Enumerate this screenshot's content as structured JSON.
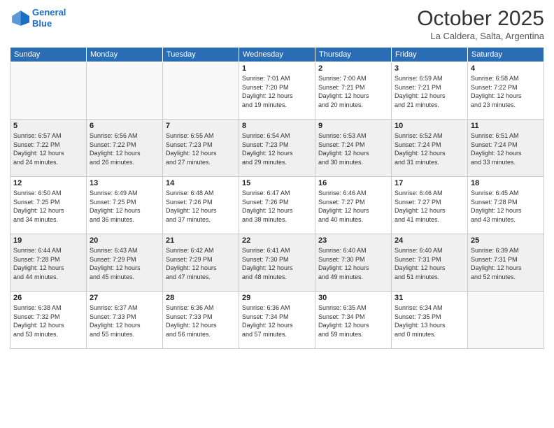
{
  "header": {
    "logo_line1": "General",
    "logo_line2": "Blue",
    "month": "October 2025",
    "location": "La Caldera, Salta, Argentina"
  },
  "weekdays": [
    "Sunday",
    "Monday",
    "Tuesday",
    "Wednesday",
    "Thursday",
    "Friday",
    "Saturday"
  ],
  "weeks": [
    [
      {
        "day": "",
        "info": ""
      },
      {
        "day": "",
        "info": ""
      },
      {
        "day": "",
        "info": ""
      },
      {
        "day": "1",
        "info": "Sunrise: 7:01 AM\nSunset: 7:20 PM\nDaylight: 12 hours\nand 19 minutes."
      },
      {
        "day": "2",
        "info": "Sunrise: 7:00 AM\nSunset: 7:21 PM\nDaylight: 12 hours\nand 20 minutes."
      },
      {
        "day": "3",
        "info": "Sunrise: 6:59 AM\nSunset: 7:21 PM\nDaylight: 12 hours\nand 21 minutes."
      },
      {
        "day": "4",
        "info": "Sunrise: 6:58 AM\nSunset: 7:22 PM\nDaylight: 12 hours\nand 23 minutes."
      }
    ],
    [
      {
        "day": "5",
        "info": "Sunrise: 6:57 AM\nSunset: 7:22 PM\nDaylight: 12 hours\nand 24 minutes."
      },
      {
        "day": "6",
        "info": "Sunrise: 6:56 AM\nSunset: 7:22 PM\nDaylight: 12 hours\nand 26 minutes."
      },
      {
        "day": "7",
        "info": "Sunrise: 6:55 AM\nSunset: 7:23 PM\nDaylight: 12 hours\nand 27 minutes."
      },
      {
        "day": "8",
        "info": "Sunrise: 6:54 AM\nSunset: 7:23 PM\nDaylight: 12 hours\nand 29 minutes."
      },
      {
        "day": "9",
        "info": "Sunrise: 6:53 AM\nSunset: 7:24 PM\nDaylight: 12 hours\nand 30 minutes."
      },
      {
        "day": "10",
        "info": "Sunrise: 6:52 AM\nSunset: 7:24 PM\nDaylight: 12 hours\nand 31 minutes."
      },
      {
        "day": "11",
        "info": "Sunrise: 6:51 AM\nSunset: 7:24 PM\nDaylight: 12 hours\nand 33 minutes."
      }
    ],
    [
      {
        "day": "12",
        "info": "Sunrise: 6:50 AM\nSunset: 7:25 PM\nDaylight: 12 hours\nand 34 minutes."
      },
      {
        "day": "13",
        "info": "Sunrise: 6:49 AM\nSunset: 7:25 PM\nDaylight: 12 hours\nand 36 minutes."
      },
      {
        "day": "14",
        "info": "Sunrise: 6:48 AM\nSunset: 7:26 PM\nDaylight: 12 hours\nand 37 minutes."
      },
      {
        "day": "15",
        "info": "Sunrise: 6:47 AM\nSunset: 7:26 PM\nDaylight: 12 hours\nand 38 minutes."
      },
      {
        "day": "16",
        "info": "Sunrise: 6:46 AM\nSunset: 7:27 PM\nDaylight: 12 hours\nand 40 minutes."
      },
      {
        "day": "17",
        "info": "Sunrise: 6:46 AM\nSunset: 7:27 PM\nDaylight: 12 hours\nand 41 minutes."
      },
      {
        "day": "18",
        "info": "Sunrise: 6:45 AM\nSunset: 7:28 PM\nDaylight: 12 hours\nand 43 minutes."
      }
    ],
    [
      {
        "day": "19",
        "info": "Sunrise: 6:44 AM\nSunset: 7:28 PM\nDaylight: 12 hours\nand 44 minutes."
      },
      {
        "day": "20",
        "info": "Sunrise: 6:43 AM\nSunset: 7:29 PM\nDaylight: 12 hours\nand 45 minutes."
      },
      {
        "day": "21",
        "info": "Sunrise: 6:42 AM\nSunset: 7:29 PM\nDaylight: 12 hours\nand 47 minutes."
      },
      {
        "day": "22",
        "info": "Sunrise: 6:41 AM\nSunset: 7:30 PM\nDaylight: 12 hours\nand 48 minutes."
      },
      {
        "day": "23",
        "info": "Sunrise: 6:40 AM\nSunset: 7:30 PM\nDaylight: 12 hours\nand 49 minutes."
      },
      {
        "day": "24",
        "info": "Sunrise: 6:40 AM\nSunset: 7:31 PM\nDaylight: 12 hours\nand 51 minutes."
      },
      {
        "day": "25",
        "info": "Sunrise: 6:39 AM\nSunset: 7:31 PM\nDaylight: 12 hours\nand 52 minutes."
      }
    ],
    [
      {
        "day": "26",
        "info": "Sunrise: 6:38 AM\nSunset: 7:32 PM\nDaylight: 12 hours\nand 53 minutes."
      },
      {
        "day": "27",
        "info": "Sunrise: 6:37 AM\nSunset: 7:33 PM\nDaylight: 12 hours\nand 55 minutes."
      },
      {
        "day": "28",
        "info": "Sunrise: 6:36 AM\nSunset: 7:33 PM\nDaylight: 12 hours\nand 56 minutes."
      },
      {
        "day": "29",
        "info": "Sunrise: 6:36 AM\nSunset: 7:34 PM\nDaylight: 12 hours\nand 57 minutes."
      },
      {
        "day": "30",
        "info": "Sunrise: 6:35 AM\nSunset: 7:34 PM\nDaylight: 12 hours\nand 59 minutes."
      },
      {
        "day": "31",
        "info": "Sunrise: 6:34 AM\nSunset: 7:35 PM\nDaylight: 13 hours\nand 0 minutes."
      },
      {
        "day": "",
        "info": ""
      }
    ]
  ]
}
